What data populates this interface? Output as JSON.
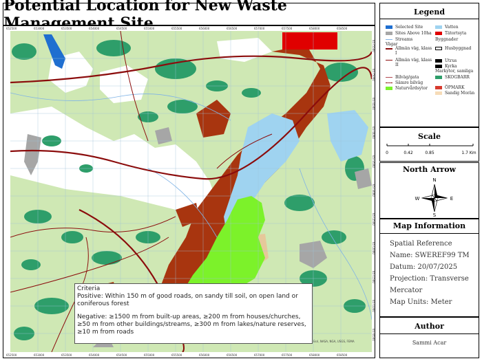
{
  "title": "Potential Location for New Waste Management Site",
  "map": {
    "x_ticks": [
      "652500",
      "653000",
      "653500",
      "654000",
      "654500",
      "655000",
      "655500",
      "656000",
      "656500",
      "657000",
      "657500",
      "658000",
      "658500"
    ],
    "y_ticks": [
      "6575500",
      "6575000",
      "6574500",
      "6574000",
      "6573500",
      "6573000",
      "6572500",
      "6572000",
      "6571500",
      "6571000",
      "6570500"
    ],
    "credit": "Esri, NASA, NGA, USGS, FEMA",
    "colors": {
      "background_land": "#cfe8b4",
      "forest": "#2e9e6a",
      "open_land": "#ffffff",
      "water": "#9fd3f0",
      "nature_reserve": "#e6c89a",
      "excluded_area": "#a8350f",
      "selected_site": "#7cf22a",
      "sites_above_10ha": "#a6a6a6",
      "built_up": "#e00000",
      "road": "#8b0c0c"
    }
  },
  "criteria": {
    "heading": "Criteria",
    "positive": "Positive: Within 150 m of good roads, on sandy till soil, on open land or coniferous forest",
    "negative": "Negative: ≥1500 m from built-up areas, ≥200 m from houses/churches, ≥50 m from other buildings/streams, ≥300 m from lakes/nature reserves, ≥10 m from roads"
  },
  "legend": {
    "title": "Legend",
    "items": [
      {
        "label": "Selected Site",
        "color": "#1f6fd0",
        "kind": "fill"
      },
      {
        "label": "Vatten",
        "color": "#9fd3f0",
        "kind": "fill"
      },
      {
        "label": "Sites Above 10ha",
        "color": "#a6a6a6",
        "kind": "fill"
      },
      {
        "label": "Tätortsyta",
        "color": "#e00000",
        "kind": "fill"
      },
      {
        "label": "Streams",
        "color": "#7fb3e6",
        "kind": "line"
      },
      {
        "label": "Byggnader",
        "color": "",
        "kind": "none"
      },
      {
        "label": "Vägar",
        "color": "",
        "kind": "none"
      },
      {
        "label": "Allmän väg, klass I",
        "color": "#8b0c0c",
        "kind": "thick"
      },
      {
        "label": "Husbyggnad",
        "color": "#ffffff",
        "kind": "outline"
      },
      {
        "label": "Allmän väg, klass II",
        "color": "#8b0c0c",
        "kind": "line"
      },
      {
        "label": "Utrus",
        "color": "#000000",
        "kind": "fill"
      },
      {
        "label": "Kyrka",
        "color": "#000000",
        "kind": "fill"
      },
      {
        "label": "Markytor, samliga",
        "color": "",
        "kind": "none"
      },
      {
        "label": "Bilväg/gata",
        "color": "#b2474f",
        "kind": "line"
      },
      {
        "label": "SKOGBARR",
        "color": "#2e9e6a",
        "kind": "fill"
      },
      {
        "label": "Sämre bilväg",
        "color": "#8b0c0c",
        "kind": "dash"
      },
      {
        "label": "ÖPMARK",
        "color": "#d73b2e",
        "kind": "fill"
      },
      {
        "label": "Naturvårdsytor",
        "color": "#7cf22a",
        "kind": "fill"
      },
      {
        "label": "Sandig Morän",
        "color": "#f6dcb8",
        "kind": "fill"
      }
    ]
  },
  "scale": {
    "title": "Scale",
    "labels": [
      "0",
      "0.42",
      "0.85",
      "1.7 Km"
    ]
  },
  "north_arrow": {
    "title": "North Arrow",
    "n": "N",
    "s": "S",
    "e": "E",
    "w": "W"
  },
  "map_info": {
    "title": "Map Information",
    "lines": [
      "Spatial Reference",
      "Name: SWEREF99 TM",
      "Datum: 20/07/2025",
      "Projection: Transverse",
      "Mercator",
      "Map Units: Meter"
    ]
  },
  "author": {
    "title": "Author",
    "name": "Sammi Acar"
  }
}
